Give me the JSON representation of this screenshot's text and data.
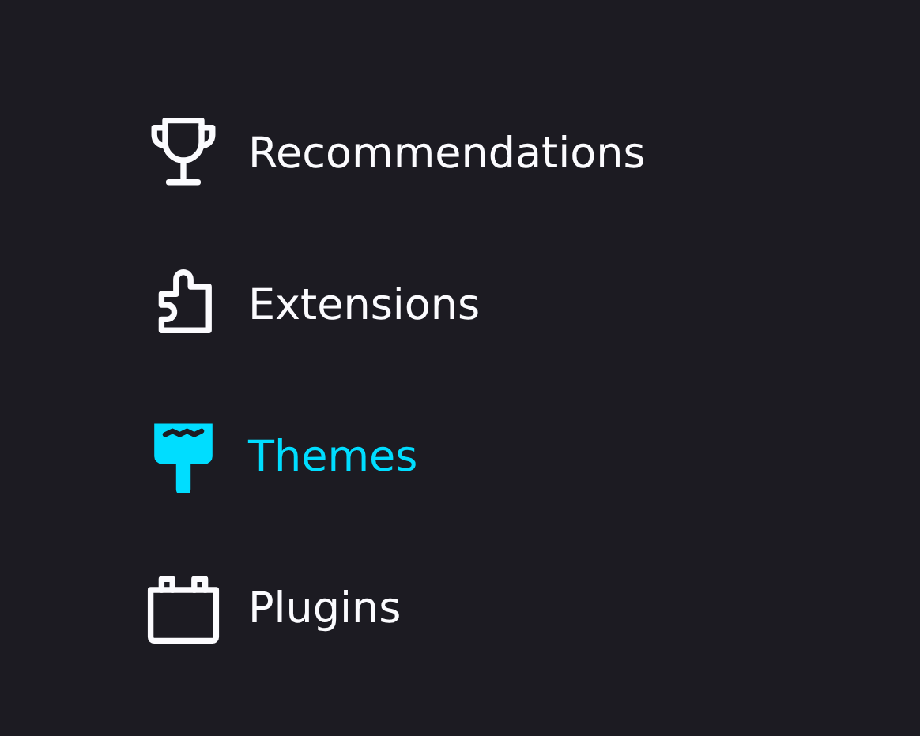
{
  "sidebar": {
    "items": [
      {
        "label": "Recommendations",
        "kind": "trophy",
        "selected": false
      },
      {
        "label": "Extensions",
        "kind": "puzzle",
        "selected": false
      },
      {
        "label": "Themes",
        "kind": "brush",
        "selected": true
      },
      {
        "label": "Plugins",
        "kind": "plugin",
        "selected": false
      }
    ]
  }
}
